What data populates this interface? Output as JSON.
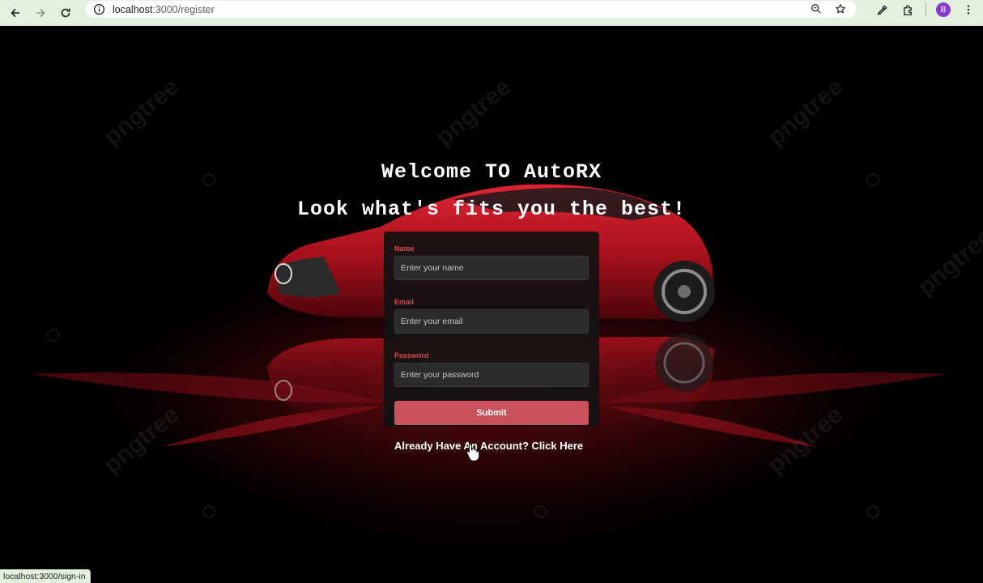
{
  "browser": {
    "url_host": "localhost",
    "url_path": ":3000/register",
    "profile_initial": "B",
    "status_url": "localhost:3000/sign-in"
  },
  "page": {
    "title": "Welcome TO AutoRX",
    "subtitle": "Look what's fits you the best!",
    "watermark": "pngtree"
  },
  "form": {
    "name_label": "Name",
    "name_placeholder": "Enter your name",
    "email_label": "Email",
    "email_placeholder": "Enter your email",
    "password_label": "Password",
    "password_placeholder": "Enter your password",
    "submit_label": "Submit"
  },
  "links": {
    "signin_text": "Already Have An Account? Click Here"
  },
  "colors": {
    "accent_red": "#d6474d",
    "button_red": "#c9515a",
    "chrome_green": "#e3f1de"
  }
}
